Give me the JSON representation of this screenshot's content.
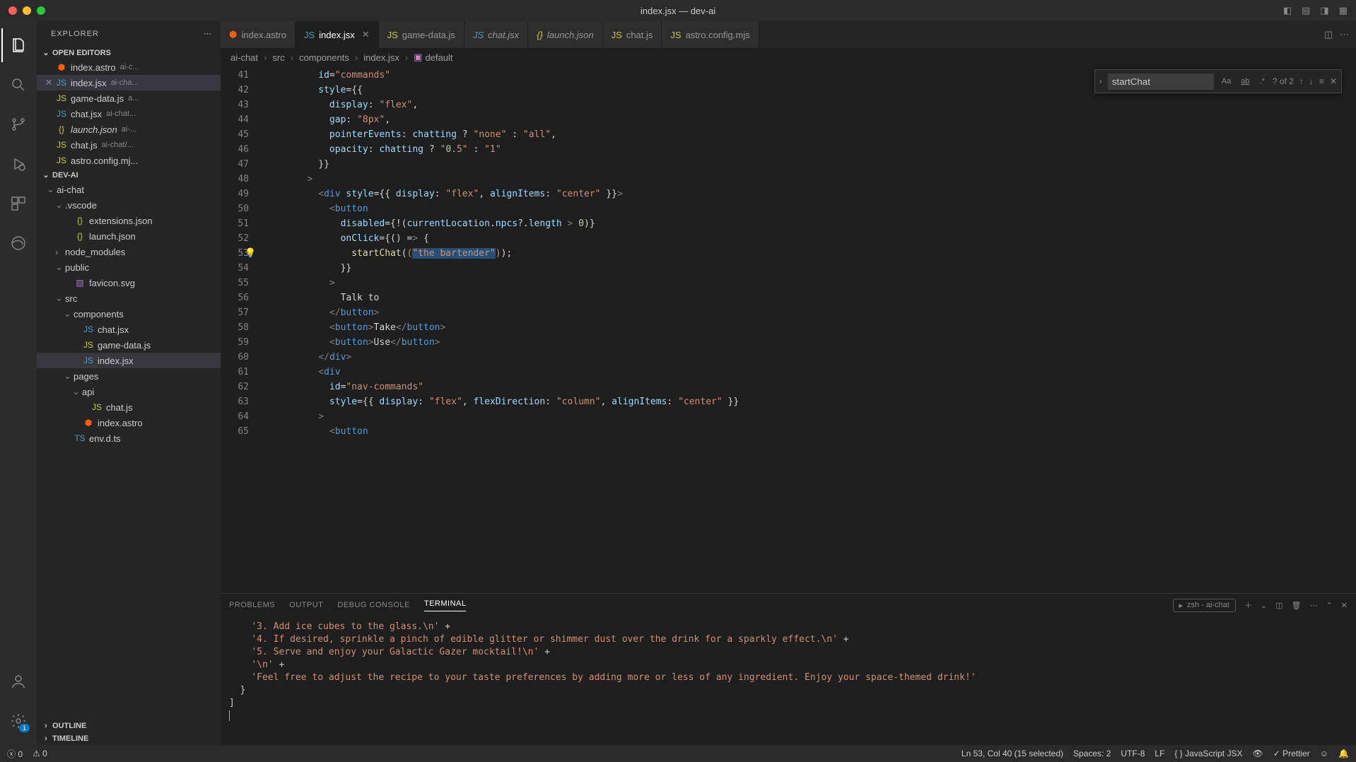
{
  "window": {
    "title": "index.jsx — dev-ai"
  },
  "sidebar": {
    "title": "EXPLORER",
    "sections": {
      "openEditors": "OPEN EDITORS",
      "project": "DEV-AI",
      "outline": "OUTLINE",
      "timeline": "TIMELINE"
    }
  },
  "openEditors": [
    {
      "name": "index.astro",
      "meta": "ai-c...",
      "icon": "astro"
    },
    {
      "name": "index.jsx",
      "meta": "ai-cha...",
      "icon": "jsx",
      "close": true,
      "active": true
    },
    {
      "name": "game-data.js",
      "meta": "a...",
      "icon": "js"
    },
    {
      "name": "chat.jsx",
      "meta": "ai-chat...",
      "icon": "jsx"
    },
    {
      "name": "launch.json",
      "meta": "ai-...",
      "icon": "json",
      "italic": true
    },
    {
      "name": "chat.js",
      "meta": "ai-chat/...",
      "icon": "js"
    },
    {
      "name": "astro.config.mj...",
      "meta": "",
      "icon": "mjs"
    }
  ],
  "fileTree": [
    {
      "depth": 0,
      "type": "folder-open",
      "name": "ai-chat"
    },
    {
      "depth": 1,
      "type": "folder-open",
      "name": ".vscode"
    },
    {
      "depth": 2,
      "type": "file",
      "icon": "json",
      "name": "extensions.json"
    },
    {
      "depth": 2,
      "type": "file",
      "icon": "json",
      "name": "launch.json"
    },
    {
      "depth": 1,
      "type": "folder",
      "name": "node_modules"
    },
    {
      "depth": 1,
      "type": "folder-open",
      "name": "public"
    },
    {
      "depth": 2,
      "type": "file",
      "icon": "svg",
      "name": "favicon.svg"
    },
    {
      "depth": 1,
      "type": "folder-open",
      "name": "src"
    },
    {
      "depth": 2,
      "type": "folder-open",
      "name": "components"
    },
    {
      "depth": 3,
      "type": "file",
      "icon": "jsx",
      "name": "chat.jsx"
    },
    {
      "depth": 3,
      "type": "file",
      "icon": "js",
      "name": "game-data.js"
    },
    {
      "depth": 3,
      "type": "file",
      "icon": "jsx",
      "name": "index.jsx",
      "active": true
    },
    {
      "depth": 2,
      "type": "folder-open",
      "name": "pages"
    },
    {
      "depth": 3,
      "type": "folder-open",
      "name": "api"
    },
    {
      "depth": 4,
      "type": "file",
      "icon": "js",
      "name": "chat.js"
    },
    {
      "depth": 3,
      "type": "file",
      "icon": "astro",
      "name": "index.astro"
    },
    {
      "depth": 2,
      "type": "file",
      "icon": "ts",
      "name": "env.d.ts"
    }
  ],
  "tabs": [
    {
      "label": "index.astro",
      "icon": "astro"
    },
    {
      "label": "index.jsx",
      "icon": "jsx",
      "active": true,
      "close": true
    },
    {
      "label": "game-data.js",
      "icon": "js"
    },
    {
      "label": "chat.jsx",
      "icon": "jsx",
      "italic": true
    },
    {
      "label": "launch.json",
      "icon": "json",
      "italic": true
    },
    {
      "label": "chat.js",
      "icon": "js"
    },
    {
      "label": "astro.config.mjs",
      "icon": "mjs"
    }
  ],
  "breadcrumbs": [
    "ai-chat",
    "src",
    "components",
    "index.jsx",
    "default"
  ],
  "find": {
    "value": "startChat",
    "result": "? of 2",
    "caseLabel": "Aa",
    "wordLabel": "ab",
    "regexLabel": ".*"
  },
  "code": {
    "startLine": 41,
    "bulbLine": 53,
    "lines": [
      "          id=\"commands\"",
      "          style={{",
      "            display: \"flex\",",
      "            gap: \"8px\",",
      "            pointerEvents: chatting ? \"none\" : \"all\",",
      "            opacity: chatting ? \"0.5\" : \"1\"",
      "          }}",
      "        >",
      "          <div style={{ display: \"flex\", alignItems: \"center\" }}>",
      "            <button",
      "              disabled={!(currentLocation.npcs?.length > 0)}",
      "              onClick={() => {",
      "                startChat(\"the bartender\");",
      "              }}",
      "            >",
      "              Talk to",
      "            </button>",
      "            <button>Take</button>",
      "            <button>Use</button>",
      "          </div>",
      "          <div",
      "            id=\"nav-commands\"",
      "            style={{ display: \"flex\", flexDirection: \"column\", alignItems: \"center\" }}",
      "          >",
      "            <button"
    ]
  },
  "panel": {
    "tabs": [
      "PROBLEMS",
      "OUTPUT",
      "DEBUG CONSOLE",
      "TERMINAL"
    ],
    "activeTab": 3,
    "terminalLabel": "zsh - ai-chat"
  },
  "terminal": [
    "    '3. Add ice cubes to the glass.\\n' +",
    "    '4. If desired, sprinkle a pinch of edible glitter or shimmer dust over the drink for a sparkly effect.\\n' +",
    "    '5. Serve and enjoy your Galactic Gazer mocktail!\\n' +",
    "    '\\n' +",
    "    'Feel free to adjust the recipe to your taste preferences by adding more or less of any ingredient. Enjoy your space-themed drink!'",
    "  }",
    "]"
  ],
  "status": {
    "errors": "0",
    "warnings": "0",
    "cursor": "Ln 53, Col 40 (15 selected)",
    "spaces": "Spaces: 2",
    "encoding": "UTF-8",
    "eol": "LF",
    "lang": "JavaScript JSX",
    "prettier": "Prettier"
  },
  "iconGlyphs": {
    "astro": "⬢",
    "jsx": "JS",
    "js": "JS",
    "json": "{}",
    "ts": "TS",
    "svg": "▧",
    "mjs": "JS"
  }
}
